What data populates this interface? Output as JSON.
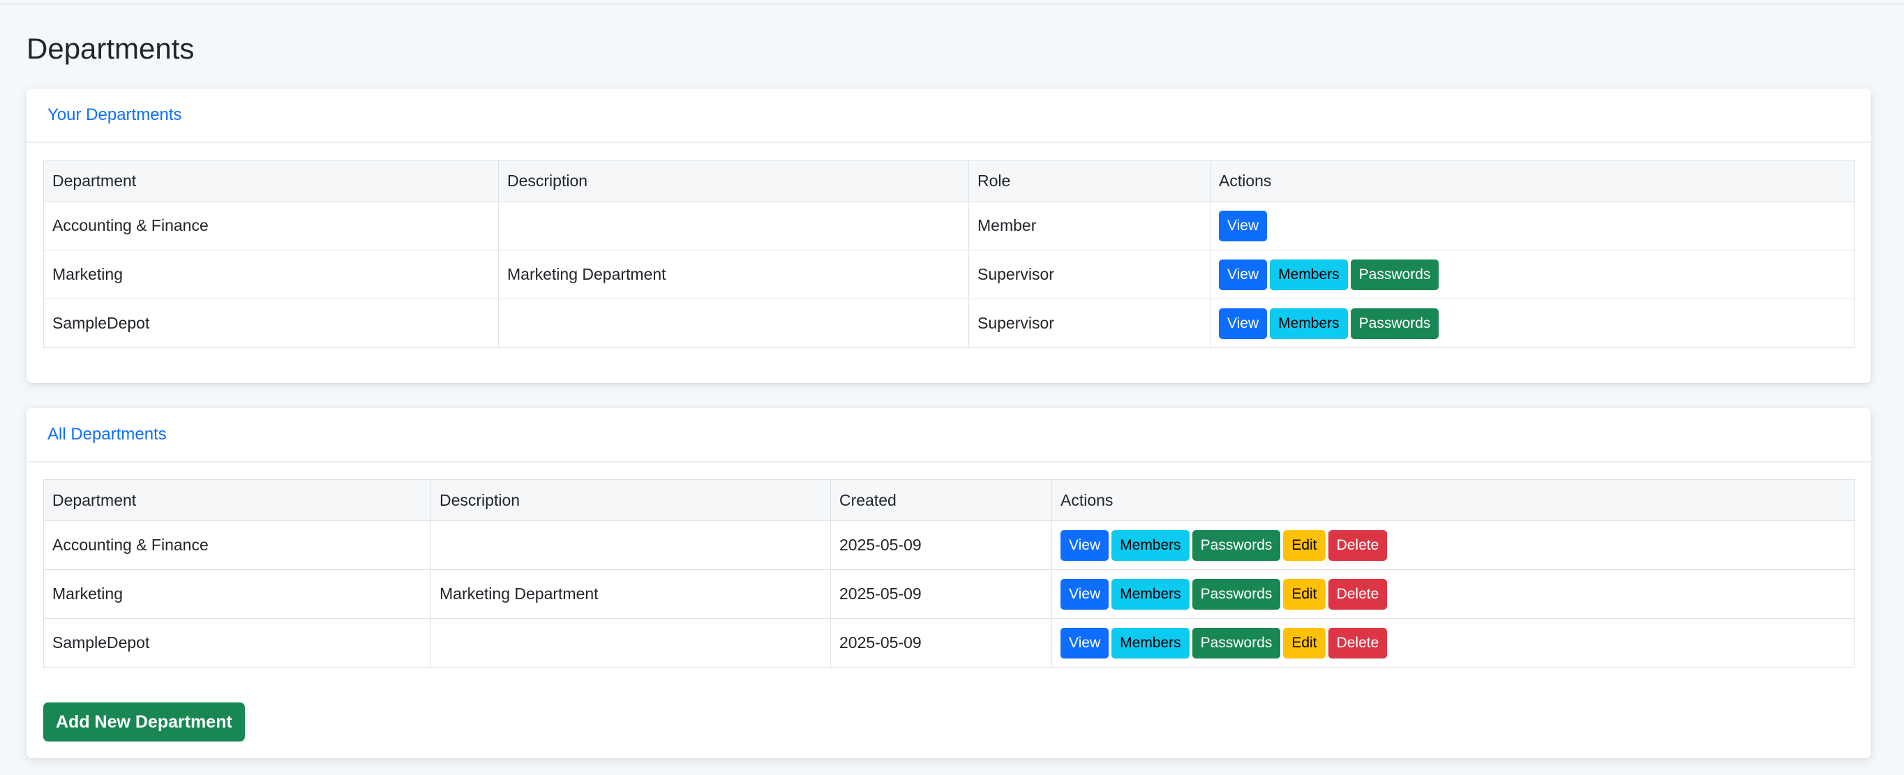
{
  "page": {
    "title": "Departments"
  },
  "your_departments": {
    "title": "Your Departments",
    "columns": [
      "Department",
      "Description",
      "Role",
      "Actions"
    ],
    "rows": [
      {
        "department": "Accounting & Finance",
        "description": "",
        "role": "Member",
        "actions": [
          "View"
        ]
      },
      {
        "department": "Marketing",
        "description": "Marketing Department",
        "role": "Supervisor",
        "actions": [
          "View",
          "Members",
          "Passwords"
        ]
      },
      {
        "department": "SampleDepot",
        "description": "",
        "role": "Supervisor",
        "actions": [
          "View",
          "Members",
          "Passwords"
        ]
      }
    ]
  },
  "all_departments": {
    "title": "All Departments",
    "columns": [
      "Department",
      "Description",
      "Created",
      "Actions"
    ],
    "rows": [
      {
        "department": "Accounting & Finance",
        "description": "",
        "created": "2025-05-09",
        "actions": [
          "View",
          "Members",
          "Passwords",
          "Edit",
          "Delete"
        ]
      },
      {
        "department": "Marketing",
        "description": "Marketing Department",
        "created": "2025-05-09",
        "actions": [
          "View",
          "Members",
          "Passwords",
          "Edit",
          "Delete"
        ]
      },
      {
        "department": "SampleDepot",
        "description": "",
        "created": "2025-05-09",
        "actions": [
          "View",
          "Members",
          "Passwords",
          "Edit",
          "Delete"
        ]
      }
    ],
    "add_button_label": "Add New Department"
  },
  "colors": {
    "primary": "#0d6efd",
    "info": "#0dcaf0",
    "success": "#198754",
    "warning": "#ffc107",
    "danger": "#dc3545",
    "background": "#f5f8fb"
  }
}
